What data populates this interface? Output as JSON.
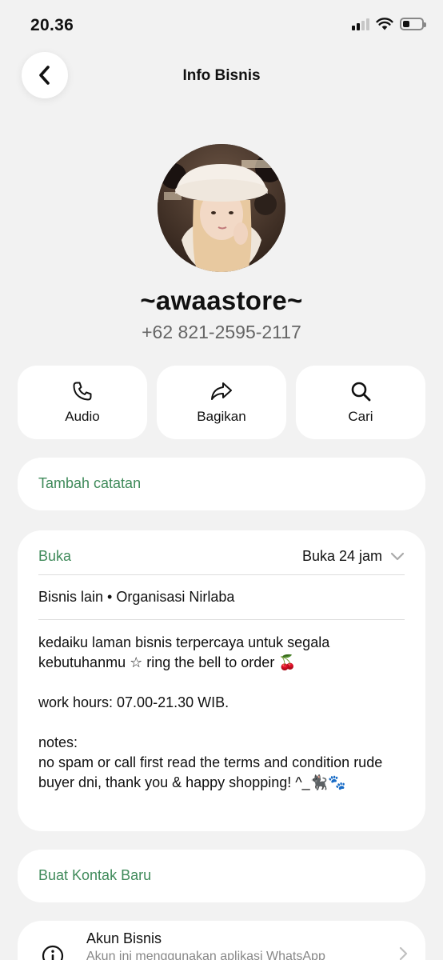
{
  "status_bar": {
    "time": "20.36",
    "battery_level": 0.35,
    "signal_bars": 4,
    "signal_active": 2
  },
  "nav": {
    "title": "Info Bisnis"
  },
  "profile": {
    "name": "~awaastore~",
    "phone": "+62 821-2595-2117"
  },
  "actions": [
    {
      "label": "Audio",
      "icon": "phone-icon"
    },
    {
      "label": "Bagikan",
      "icon": "share-icon"
    },
    {
      "label": "Cari",
      "icon": "search-icon"
    }
  ],
  "note_card": {
    "label": "Tambah catatan"
  },
  "business_card": {
    "hours_label": "Buka",
    "hours_value": "Buka 24 jam",
    "category": "Bisnis lain • Organisasi Nirlaba",
    "description": "kedaiku  laman bisnis terpercaya untuk segala kebutuhanmu ☆ ring the bell to order 🍒\n\nwork hours: 07.00-21.30 WIB.\n\nnotes:\nno spam or call first read the terms and condition rude buyer dni, thank you & happy shopping! ^_🐈‍⬛🐾"
  },
  "contact_card": {
    "label": "Buat Kontak Baru"
  },
  "account_card": {
    "title": "Akun Bisnis",
    "subtitle": "Akun ini menggunakan aplikasi WhatsApp"
  },
  "colors": {
    "accent_green": "#3f8a5a",
    "background": "#f2f2f2",
    "card": "#ffffff"
  }
}
